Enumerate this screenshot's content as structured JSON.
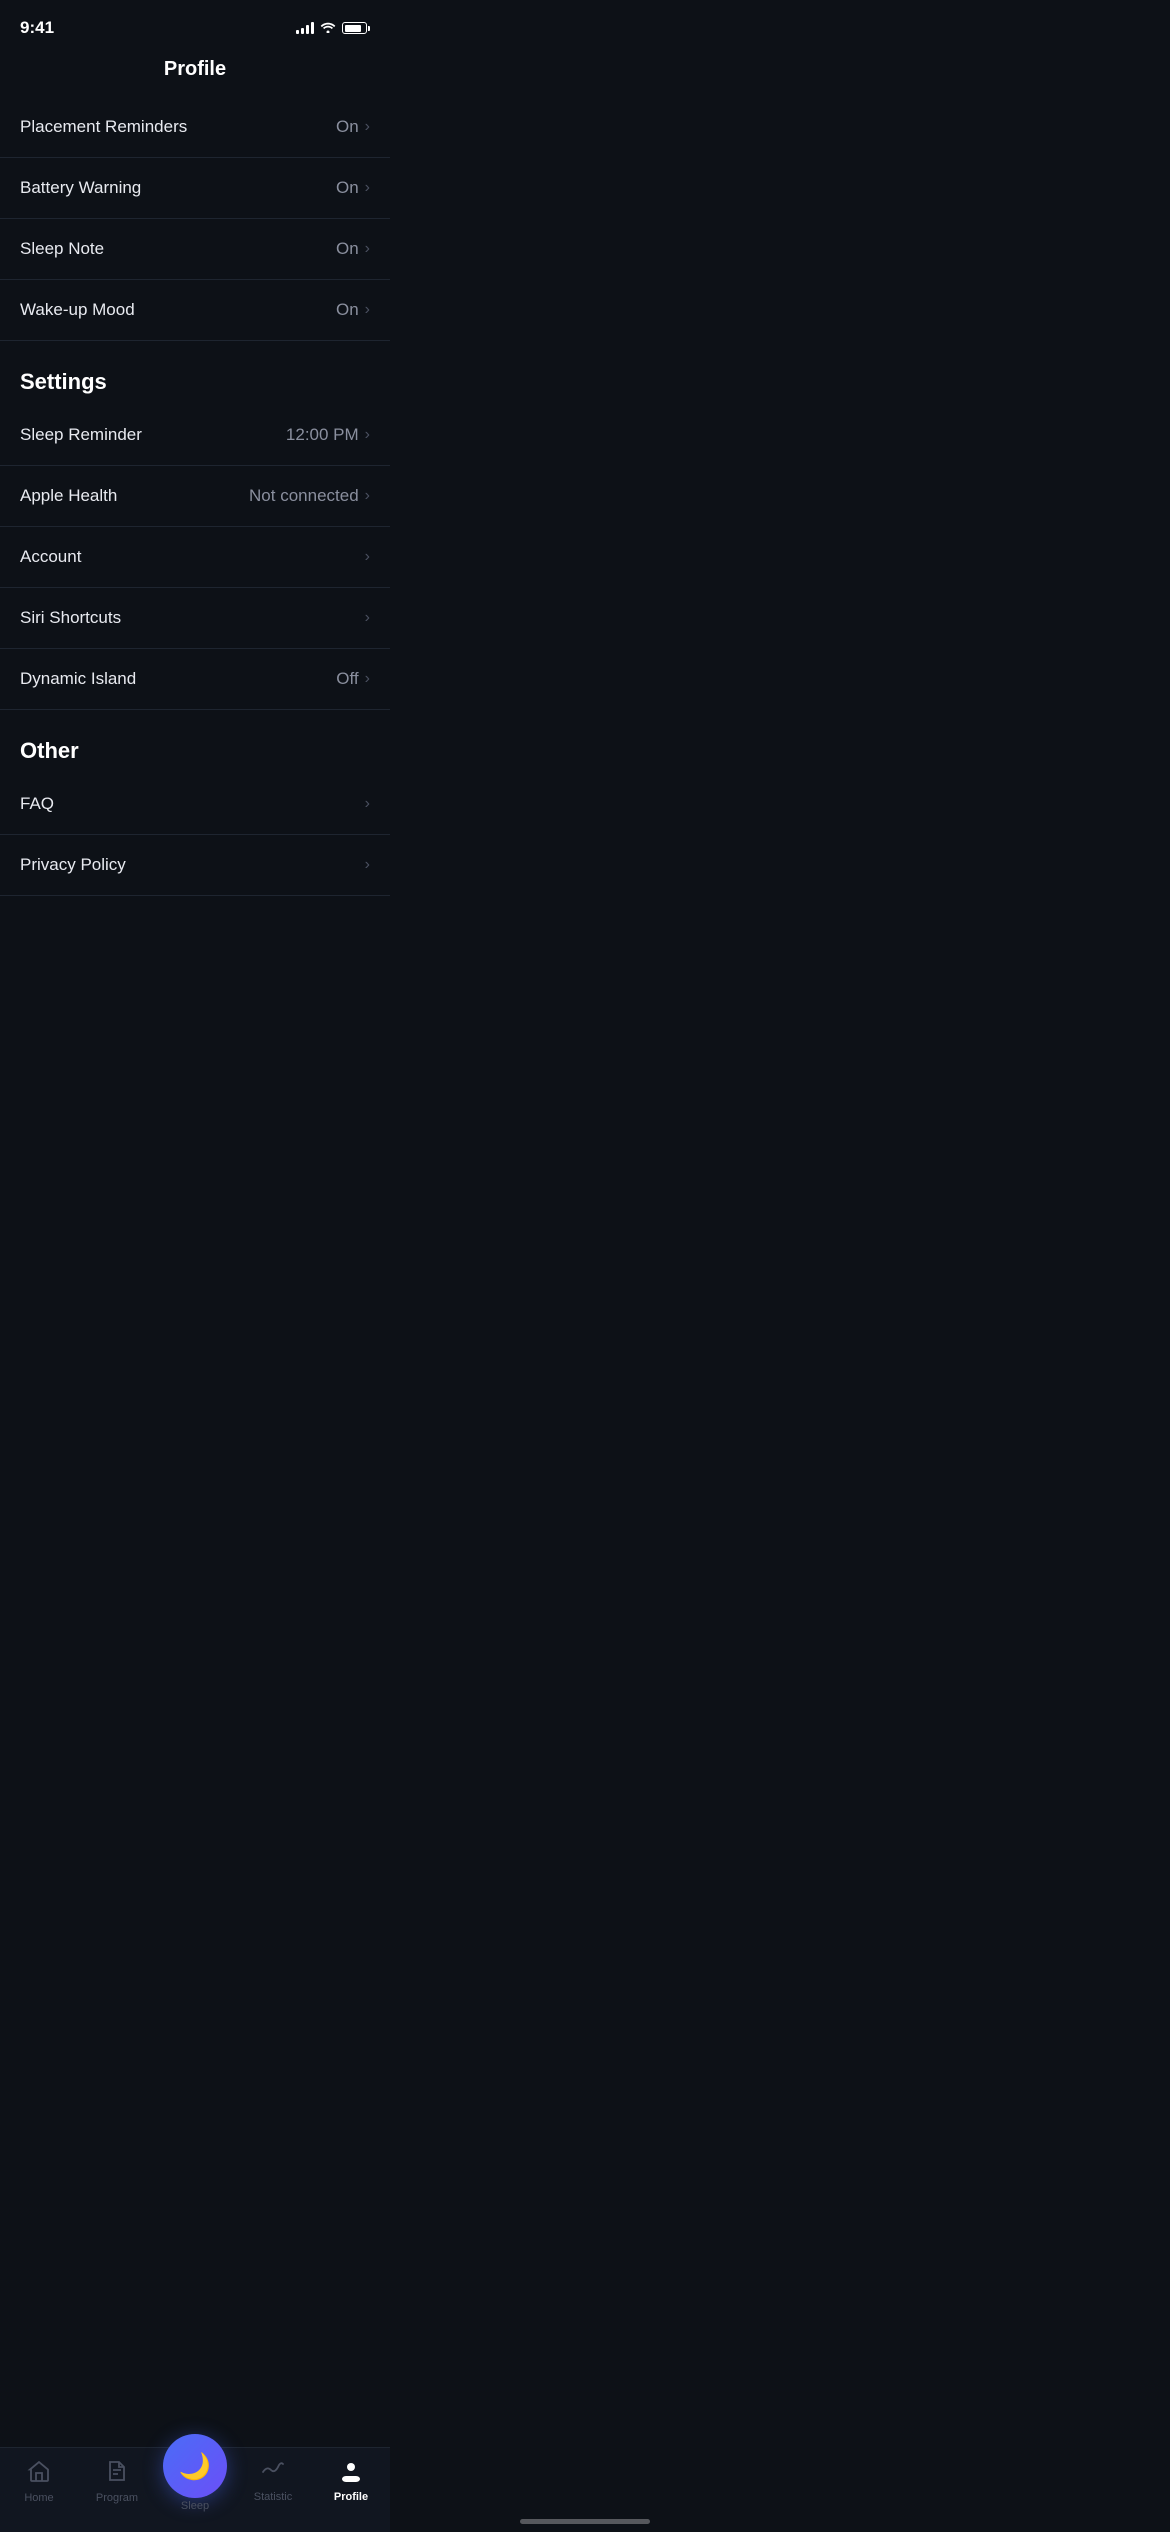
{
  "statusBar": {
    "time": "9:41",
    "batteryLevel": 80
  },
  "pageTitle": "Profile",
  "notificationItems": [
    {
      "id": "placement-reminders",
      "label": "Placement Reminders",
      "value": "On",
      "hasChevron": true
    },
    {
      "id": "battery-warning",
      "label": "Battery Warning",
      "value": "On",
      "hasChevron": true
    },
    {
      "id": "sleep-note",
      "label": "Sleep Note",
      "value": "On",
      "hasChevron": true
    },
    {
      "id": "wake-up-mood",
      "label": "Wake-up Mood",
      "value": "On",
      "hasChevron": true
    }
  ],
  "sections": {
    "settings": {
      "title": "Settings",
      "items": [
        {
          "id": "sleep-reminder",
          "label": "Sleep Reminder",
          "value": "12:00 PM",
          "hasChevron": true
        },
        {
          "id": "apple-health",
          "label": "Apple Health",
          "value": "Not connected",
          "hasChevron": true
        },
        {
          "id": "account",
          "label": "Account",
          "value": "",
          "hasChevron": true
        },
        {
          "id": "siri-shortcuts",
          "label": "Siri Shortcuts",
          "value": "",
          "hasChevron": true
        },
        {
          "id": "dynamic-island",
          "label": "Dynamic Island",
          "value": "Off",
          "hasChevron": true
        }
      ]
    },
    "other": {
      "title": "Other",
      "items": [
        {
          "id": "faq",
          "label": "FAQ",
          "value": "",
          "hasChevron": true
        },
        {
          "id": "privacy-policy",
          "label": "Privacy Policy",
          "value": "",
          "hasChevron": true
        }
      ]
    }
  },
  "tabBar": {
    "tabs": [
      {
        "id": "home",
        "label": "Home",
        "icon": "🏠",
        "active": false
      },
      {
        "id": "program",
        "label": "Program",
        "icon": "◆",
        "active": false
      },
      {
        "id": "sleep",
        "label": "Sleep",
        "icon": "🌙",
        "active": false,
        "isCenter": true
      },
      {
        "id": "statistic",
        "label": "Statistic",
        "icon": "〜",
        "active": false
      },
      {
        "id": "profile",
        "label": "Profile",
        "icon": "●",
        "active": true
      }
    ]
  }
}
